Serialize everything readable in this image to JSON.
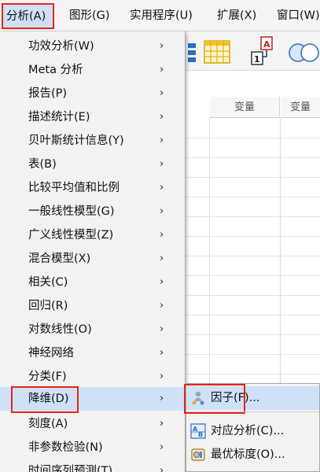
{
  "menubar": {
    "items": [
      "分析(A)",
      "图形(G)",
      "实用程序(U)",
      "扩展(X)",
      "窗口(W)"
    ],
    "active_index": 0
  },
  "grid": {
    "headers": [
      "变量",
      "变量"
    ]
  },
  "analyze_menu": {
    "items": [
      {
        "label": "功效分析(W)",
        "arrow": "›"
      },
      {
        "label": "Meta 分析",
        "arrow": "›"
      },
      {
        "label": "报告(P)",
        "arrow": "›"
      },
      {
        "label": "描述统计(E)",
        "arrow": "›"
      },
      {
        "label": "贝叶斯统计信息(Y)",
        "arrow": "›"
      },
      {
        "label": "表(B)",
        "arrow": "›"
      },
      {
        "label": "比较平均值和比例",
        "arrow": "›"
      },
      {
        "label": "一般线性模型(G)",
        "arrow": "›"
      },
      {
        "label": "广义线性模型(Z)",
        "arrow": "›"
      },
      {
        "label": "混合模型(X)",
        "arrow": "›"
      },
      {
        "label": "相关(C)",
        "arrow": "›"
      },
      {
        "label": "回归(R)",
        "arrow": "›"
      },
      {
        "label": "对数线性(O)",
        "arrow": "›"
      },
      {
        "label": "神经网络",
        "arrow": "›"
      },
      {
        "label": "分类(F)",
        "arrow": "›"
      },
      {
        "label": "降维(D)",
        "arrow": "›"
      },
      {
        "label": "刻度(A)",
        "arrow": "›"
      },
      {
        "label": "非参数检验(N)",
        "arrow": "›"
      },
      {
        "label": "时间序列预测(T)",
        "arrow": "›"
      }
    ],
    "highlighted_index": 15
  },
  "dimension_reduction_submenu": {
    "items": [
      {
        "label": "因子(F)...",
        "icon": "factor-analysis-icon"
      },
      {
        "label": "对应分析(C)...",
        "icon": "correspondence-analysis-icon"
      },
      {
        "label": "最优标度(O)...",
        "icon": "optimal-scaling-icon"
      }
    ],
    "highlighted_index": 0
  },
  "colors": {
    "annotation_red": "#e8231b",
    "highlight_blue": "#cfe1f7",
    "menu_background": "#f2f2f2"
  }
}
